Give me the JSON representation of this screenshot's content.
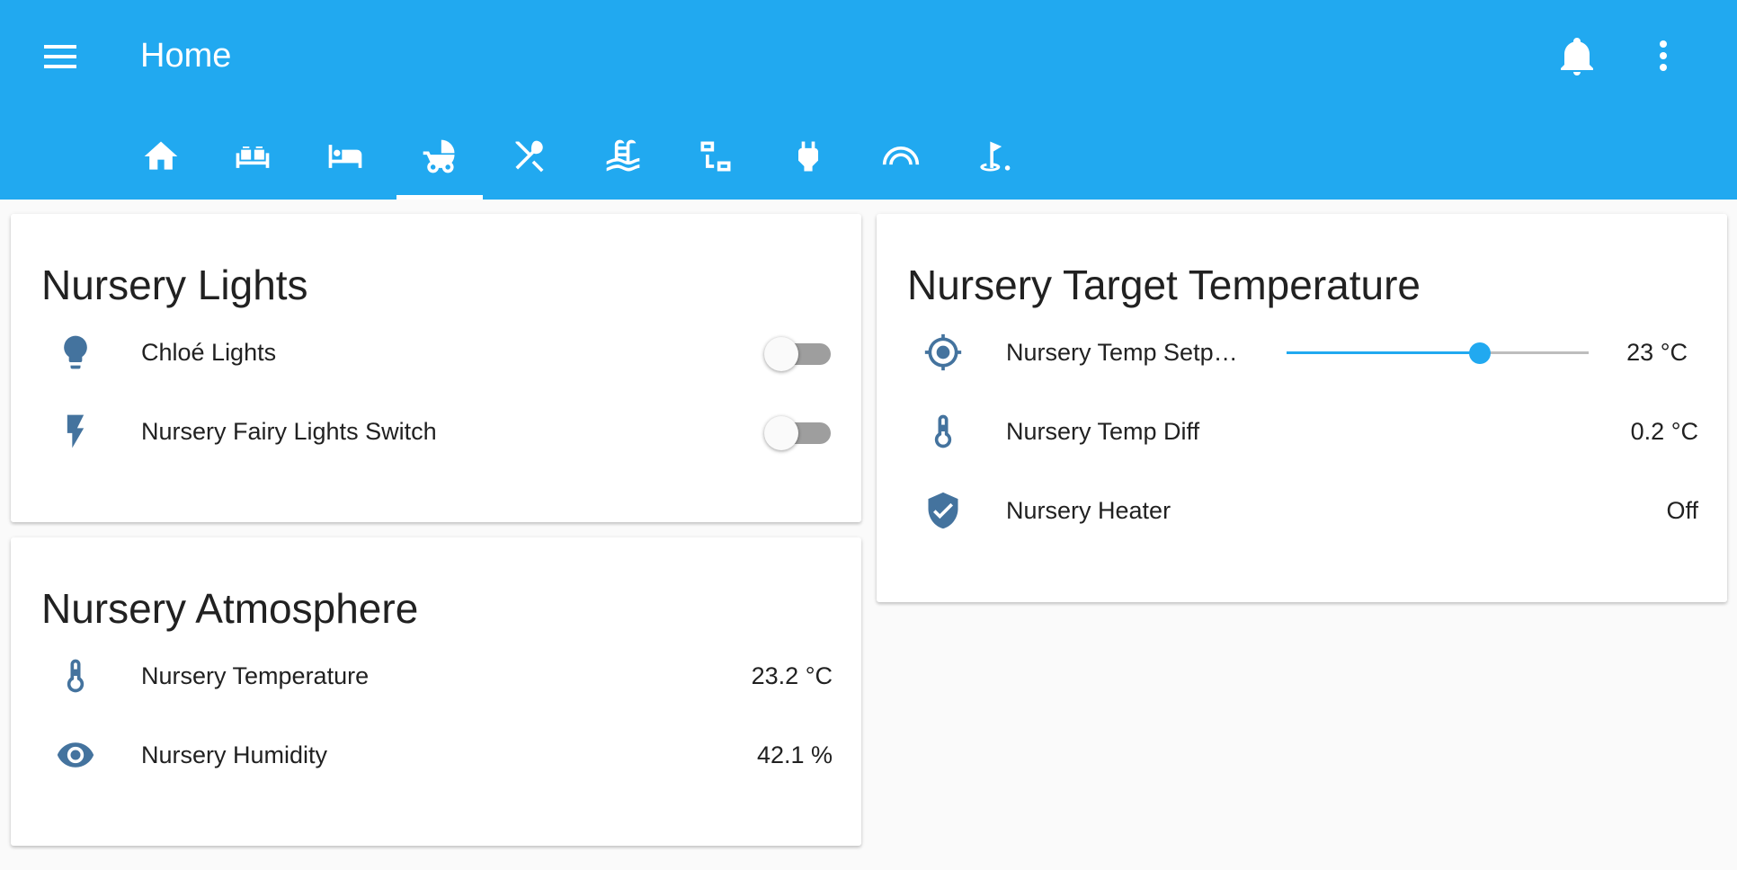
{
  "header": {
    "title": "Home",
    "menu_icon": "menu-icon",
    "notifications_icon": "bell-icon",
    "more_icon": "dots-vertical-icon",
    "background_color": "#21a9f0"
  },
  "tabs": [
    {
      "icon": "home-icon",
      "active": false
    },
    {
      "icon": "sofa-icon",
      "active": false
    },
    {
      "icon": "bed-icon",
      "active": false
    },
    {
      "icon": "baby-carriage-icon",
      "active": true
    },
    {
      "icon": "silverware-icon",
      "active": false
    },
    {
      "icon": "pool-icon",
      "active": false
    },
    {
      "icon": "network-icon",
      "active": false
    },
    {
      "icon": "power-plug-icon",
      "active": false
    },
    {
      "icon": "arch-icon",
      "active": false
    },
    {
      "icon": "golf-icon",
      "active": false
    }
  ],
  "lights_card": {
    "title": "Nursery Lights",
    "rows": [
      {
        "icon": "lightbulb-icon",
        "label": "Chloé Lights",
        "state": "off"
      },
      {
        "icon": "flash-icon",
        "label": "Nursery Fairy Lights Switch",
        "state": "off"
      }
    ]
  },
  "atmosphere_card": {
    "title": "Nursery Atmosphere",
    "rows": [
      {
        "icon": "thermometer-icon",
        "label": "Nursery Temperature",
        "value": "23.2 °C"
      },
      {
        "icon": "eye-icon",
        "label": "Nursery Humidity",
        "value": "42.1 %"
      }
    ]
  },
  "target_card": {
    "title": "Nursery Target Temperature",
    "rows": [
      {
        "icon": "crosshairs-gps-icon",
        "label": "Nursery Temp Setp…",
        "value": "23 °C",
        "slider_level": 0.64
      },
      {
        "icon": "thermometer-icon",
        "label": "Nursery Temp Diff",
        "value": "0.2 °C"
      },
      {
        "icon": "shield-check-icon",
        "label": "Nursery Heater",
        "value": "Off"
      }
    ]
  },
  "colors": {
    "accent": "#21a9f0",
    "icon": "#44739e"
  }
}
